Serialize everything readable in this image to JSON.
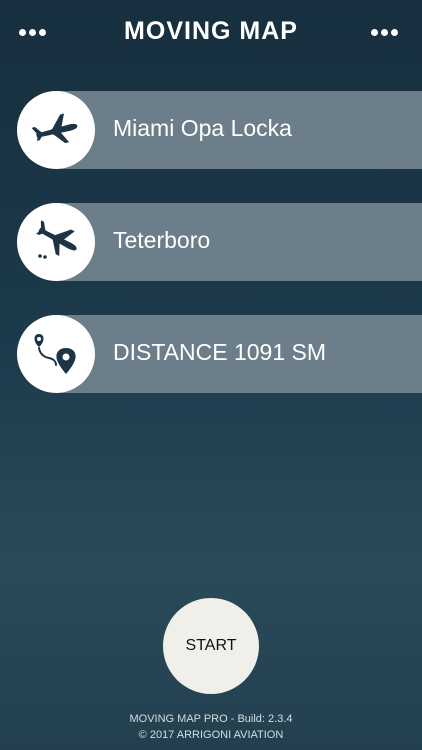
{
  "header": {
    "title": "MOVING MAP",
    "left_menu_icon": "more-dots-icon",
    "right_menu_icon": "more-dots-icon"
  },
  "rows": [
    {
      "label": "Miami Opa Locka",
      "icon": "departure-plane-icon"
    },
    {
      "label": "Teterboro",
      "icon": "arrival-plane-icon"
    },
    {
      "label": "DISTANCE  1091 SM",
      "icon": "route-pin-icon"
    }
  ],
  "start_button": {
    "label": "START"
  },
  "footer": {
    "build_line": "MOVING MAP PRO   - Build: 2.3.4",
    "copyright_line": "© 2017 ARRIGONI AVIATION"
  },
  "colors": {
    "background": "#1c3a4b",
    "row_bar": "#6b7e89",
    "circle": "#ffffff",
    "icon": "#1d3444",
    "start_button": "#f1efe9"
  }
}
